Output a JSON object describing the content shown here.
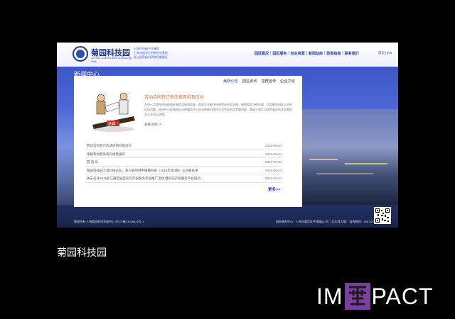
{
  "site": {
    "logo_cn": "菊园科技园",
    "logo_en": "JuYuan Science and Technology Park",
    "tagline": [
      "上海市市级产业基地",
      "上海市留学生创新创业基地",
      "浙江国家级科研院所集聚区"
    ],
    "nav": [
      "园区概况",
      "园区服务",
      "创业资源",
      "新闻动态",
      "政策指南",
      "联系我们"
    ],
    "lang": "首页 | EN"
  },
  "page": {
    "heading": "新闻中心",
    "tabs": [
      "最新公告",
      "园区资讯",
      "党群宣传",
      "企业文化"
    ],
    "feature": {
      "title": "劳动合同签订的法律风险及应对",
      "summary": "为进一步提升科技园园区服务功能和质量，帮助企业解决社理劳动合同法律，按照相关法律法规，切实解决园区企业的实际问题，经济中心提请园区法律服务中心应法律顾问提供企业劳动合同专题讲座，邀请上海大众律师事务所法学教授为企业作出讲座。",
      "more": "查看详情>>",
      "stamp": "法律"
    },
    "news": [
      {
        "title": "劳动合同签订的法律风险及应对",
        "date": "2015-09-24"
      },
      {
        "title": "德缓和加盟系统升级版发布",
        "date": "2015-09-24"
      },
      {
        "title": "圆 通 讯",
        "date": "2015-09-24"
      },
      {
        "title": "菊园科技园之高科技企业、新三板项目申报辅导班（2015年第4期）火热报名中",
        "date": "2015-09-24"
      },
      {
        "title": "关于召开2015浙江嘉定园区知识产权服务平台推广活动 暨知识产权服务平台培训...",
        "date": "2015-09-24"
      }
    ],
    "more": "更多>>"
  },
  "footer": {
    "left": "版权所有 上海菊园科技发展中心 沪ICP备13018812号-1",
    "right": "园区服务中心：上海市嘉定区平城路811号（北水湾大厦）    咨询热线：400-021-3318"
  },
  "caption": "菊园科技园",
  "brand": {
    "left": "IM",
    "right": "PACT"
  }
}
